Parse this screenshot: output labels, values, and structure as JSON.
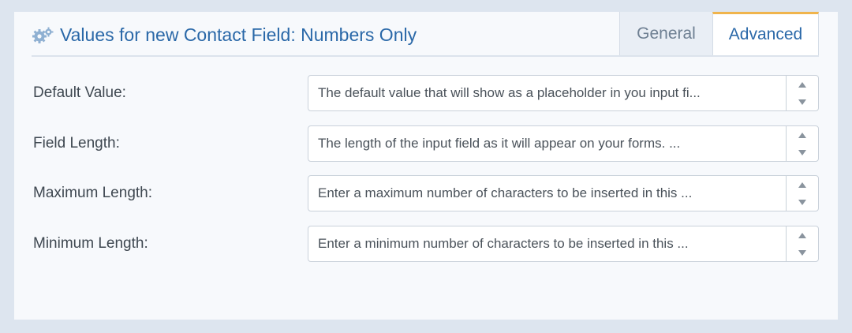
{
  "header": {
    "title": "Values for new Contact Field: Numbers Only",
    "icon": "gears-icon",
    "tabs": [
      {
        "label": "General",
        "active": false
      },
      {
        "label": "Advanced",
        "active": true
      }
    ]
  },
  "fields": [
    {
      "label": "Default Value:",
      "placeholder": "The default value that will show as a placeholder in you input fi..."
    },
    {
      "label": "Field Length:",
      "placeholder": "The length of the input field as it will appear on your forms. ..."
    },
    {
      "label": "Maximum Length:",
      "placeholder": "Enter a maximum number of characters to be inserted in this ..."
    },
    {
      "label": "Minimum Length:",
      "placeholder": "Enter a minimum number of characters to be inserted in this ..."
    }
  ],
  "colors": {
    "accent": "#2a68a8",
    "active_tab_border": "#f0b44c",
    "page_background": "#dde5ef"
  }
}
